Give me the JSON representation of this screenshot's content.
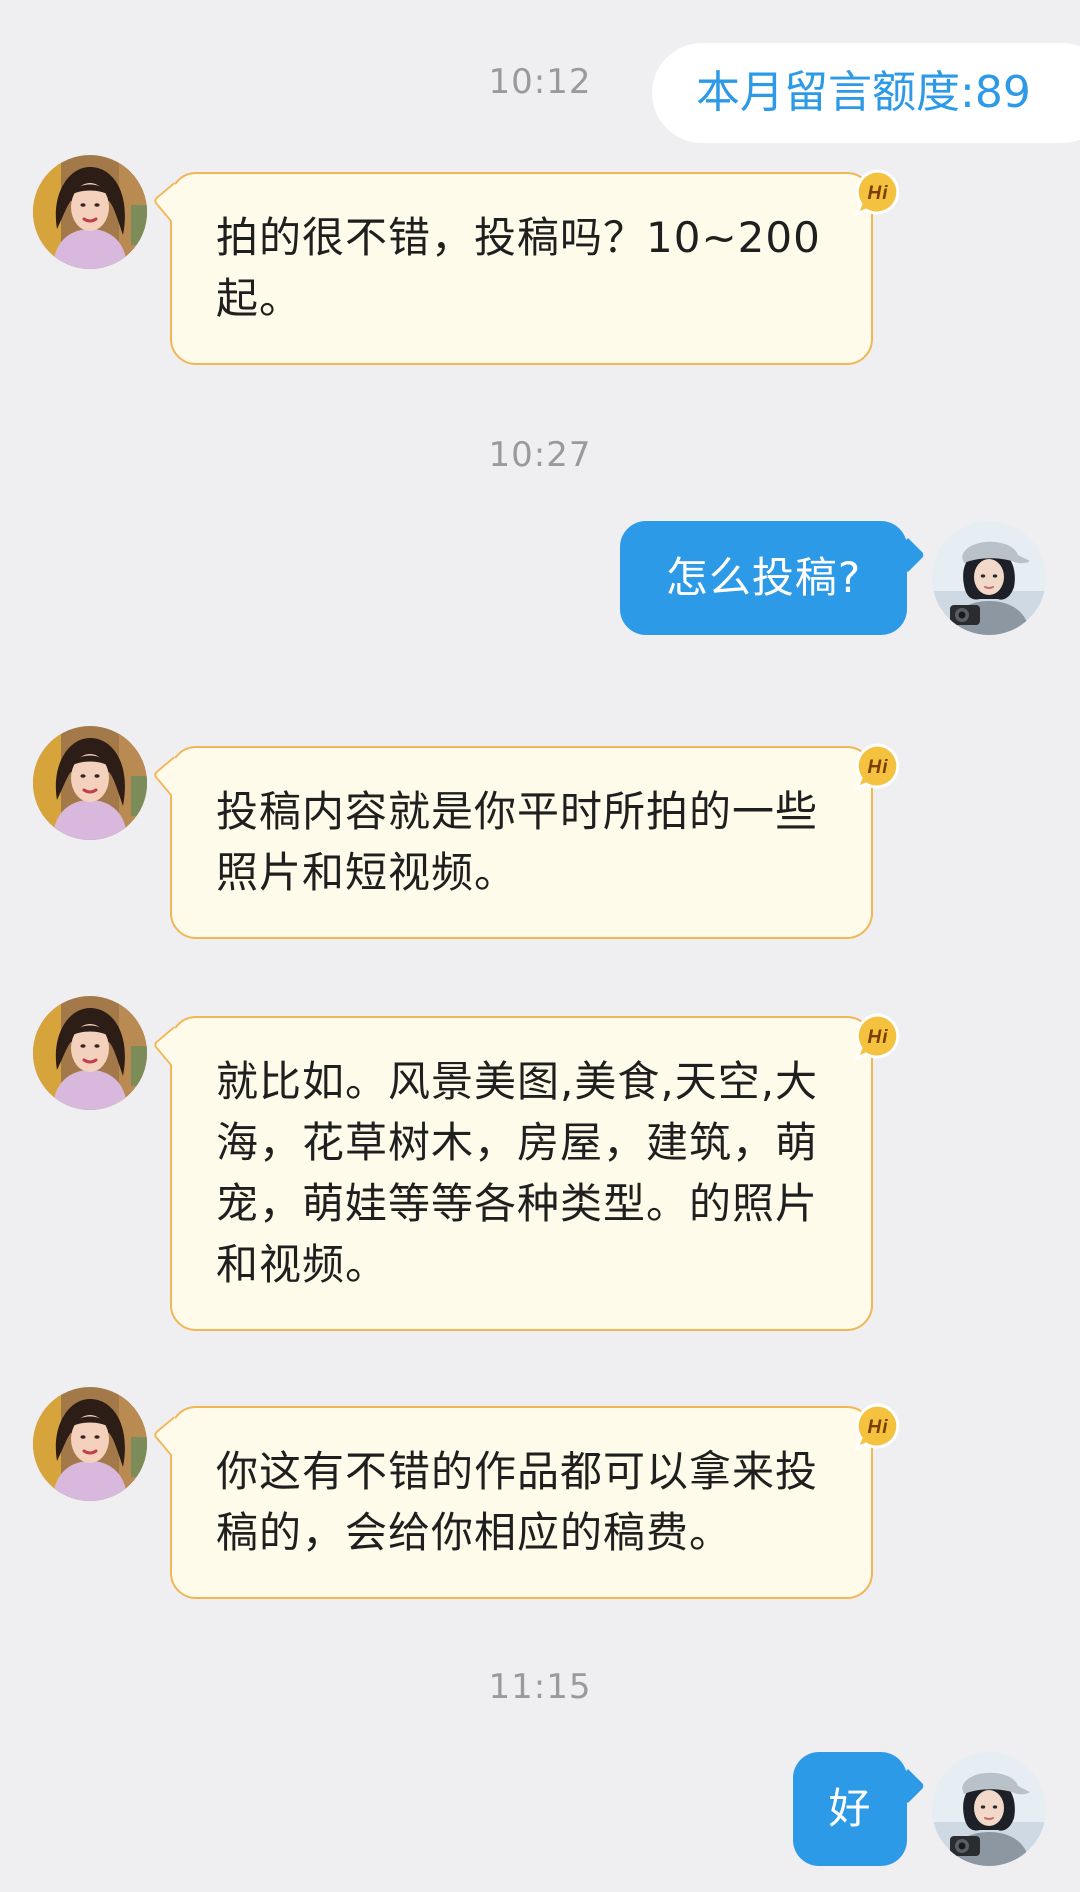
{
  "quota": {
    "label": "本月留言额度:89"
  },
  "badge": {
    "text": "Hi"
  },
  "messages": [
    {
      "time": "10:12"
    },
    {
      "text": "拍的很不错，投稿吗？10~200起。"
    },
    {
      "time": "10:27"
    },
    {
      "text": "怎么投稿?"
    },
    {
      "text": "投稿内容就是你平时所拍的一些照片和短视频。"
    },
    {
      "text": "就比如。风景美图,美食,天空,大海，花草树木，房屋，建筑，萌宠，萌娃等等各种类型。的照片和视频。"
    },
    {
      "text": "你这有不错的作品都可以拿来投稿的，会给你相应的稿费。"
    },
    {
      "time": "11:15"
    },
    {
      "text": "好"
    }
  ],
  "colors": {
    "background": "#efeff1",
    "outgoing_bubble": "#2d9ae8",
    "incoming_bubble": "#fffbea",
    "incoming_border": "#f1b656",
    "quota_text": "#2d9ae8"
  }
}
